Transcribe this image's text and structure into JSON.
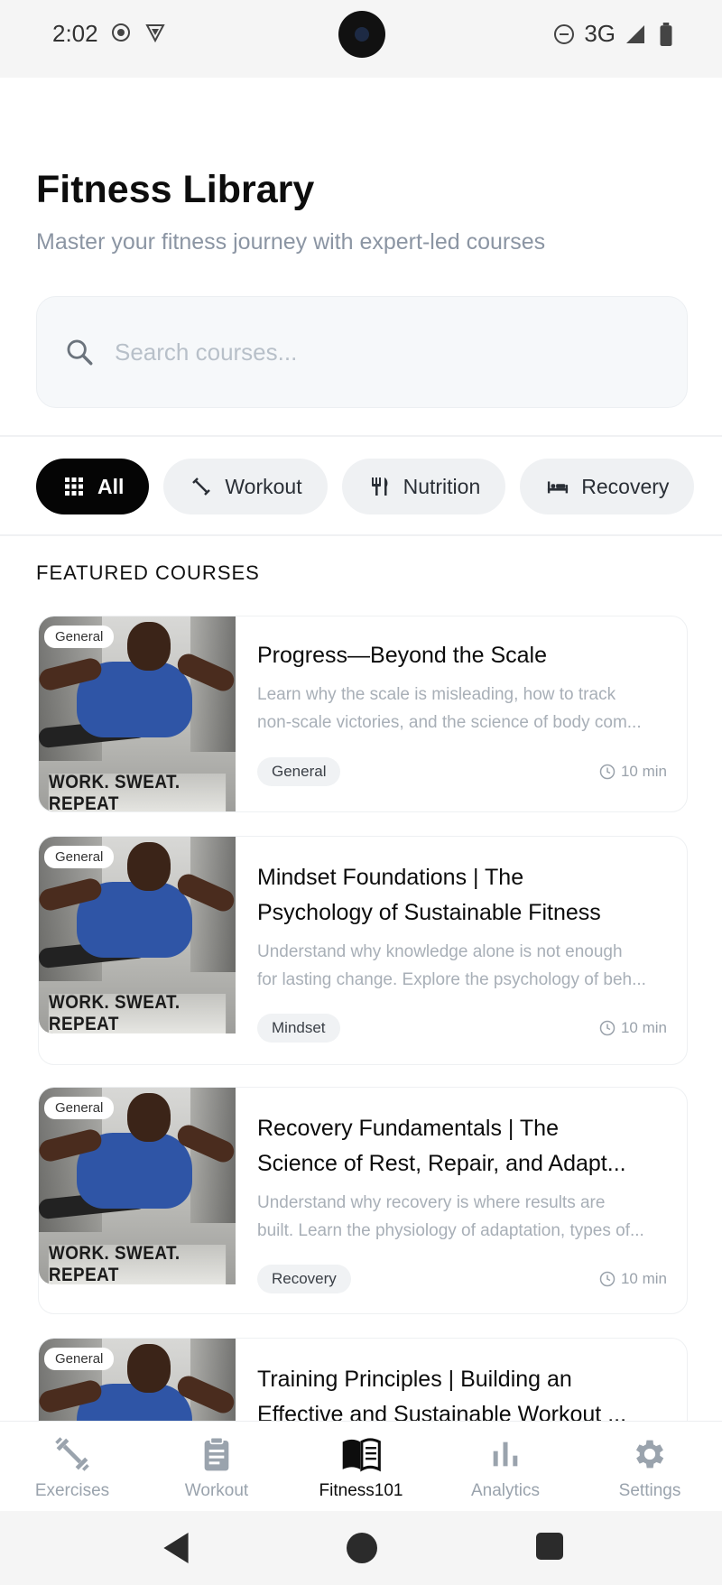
{
  "status_bar": {
    "time": "2:02",
    "network": "3G",
    "icons": [
      "record-icon",
      "vpn-shield-icon",
      "do-not-disturb-icon",
      "signal-icon",
      "battery-icon"
    ]
  },
  "header": {
    "title": "Fitness Library",
    "subtitle": "Master your fitness journey with expert-led courses"
  },
  "search": {
    "placeholder": "Search courses..."
  },
  "filters": [
    {
      "label": "All",
      "icon": "grid-icon",
      "active": true
    },
    {
      "label": "Workout",
      "icon": "dumbbell-icon",
      "active": false
    },
    {
      "label": "Nutrition",
      "icon": "fork-knife-icon",
      "active": false
    },
    {
      "label": "Recovery",
      "icon": "bed-icon",
      "active": false
    }
  ],
  "section_label": "FEATURED COURSES",
  "courses": [
    {
      "badge": "General",
      "thumb_caption": "WORK. SWEAT. REPEAT",
      "title": "Progress—Beyond the Scale",
      "desc_line1": "Learn why the scale is misleading, how to track",
      "desc_line2": "non-scale victories, and the science of body com...",
      "tag": "General",
      "duration": "10 min"
    },
    {
      "badge": "General",
      "thumb_caption": "WORK. SWEAT. REPEAT",
      "title_line1": "Mindset Foundations  |  The",
      "title_line2": "Psychology of Sustainable Fitness",
      "desc_line1": "Understand why knowledge alone is not enough",
      "desc_line2": "for lasting change. Explore the psychology of beh...",
      "tag": "Mindset",
      "duration": "10 min"
    },
    {
      "badge": "General",
      "thumb_caption": "WORK. SWEAT. REPEAT",
      "title_line1": "Recovery Fundamentals  |  The",
      "title_line2": "Science of Rest, Repair, and Adapt...",
      "desc_line1": "Understand why recovery is where results are",
      "desc_line2": "built. Learn the physiology of adaptation, types of...",
      "tag": "Recovery",
      "duration": "10 min"
    },
    {
      "badge": "General",
      "title_line1": "Training Principles  |  Building an",
      "title_line2": "Effective and Sustainable Workout ..."
    }
  ],
  "bottom_nav": [
    {
      "label": "Exercises",
      "icon": "dumbbell-icon",
      "active": false
    },
    {
      "label": "Workout",
      "icon": "clipboard-icon",
      "active": false
    },
    {
      "label": "Fitness101",
      "icon": "book-icon",
      "active": true
    },
    {
      "label": "Analytics",
      "icon": "bar-chart-icon",
      "active": false
    },
    {
      "label": "Settings",
      "icon": "gear-icon",
      "active": false
    }
  ],
  "colors": {
    "accent": "#050505",
    "muted_text": "#8b95a3",
    "chip_bg": "#eff1f3"
  }
}
